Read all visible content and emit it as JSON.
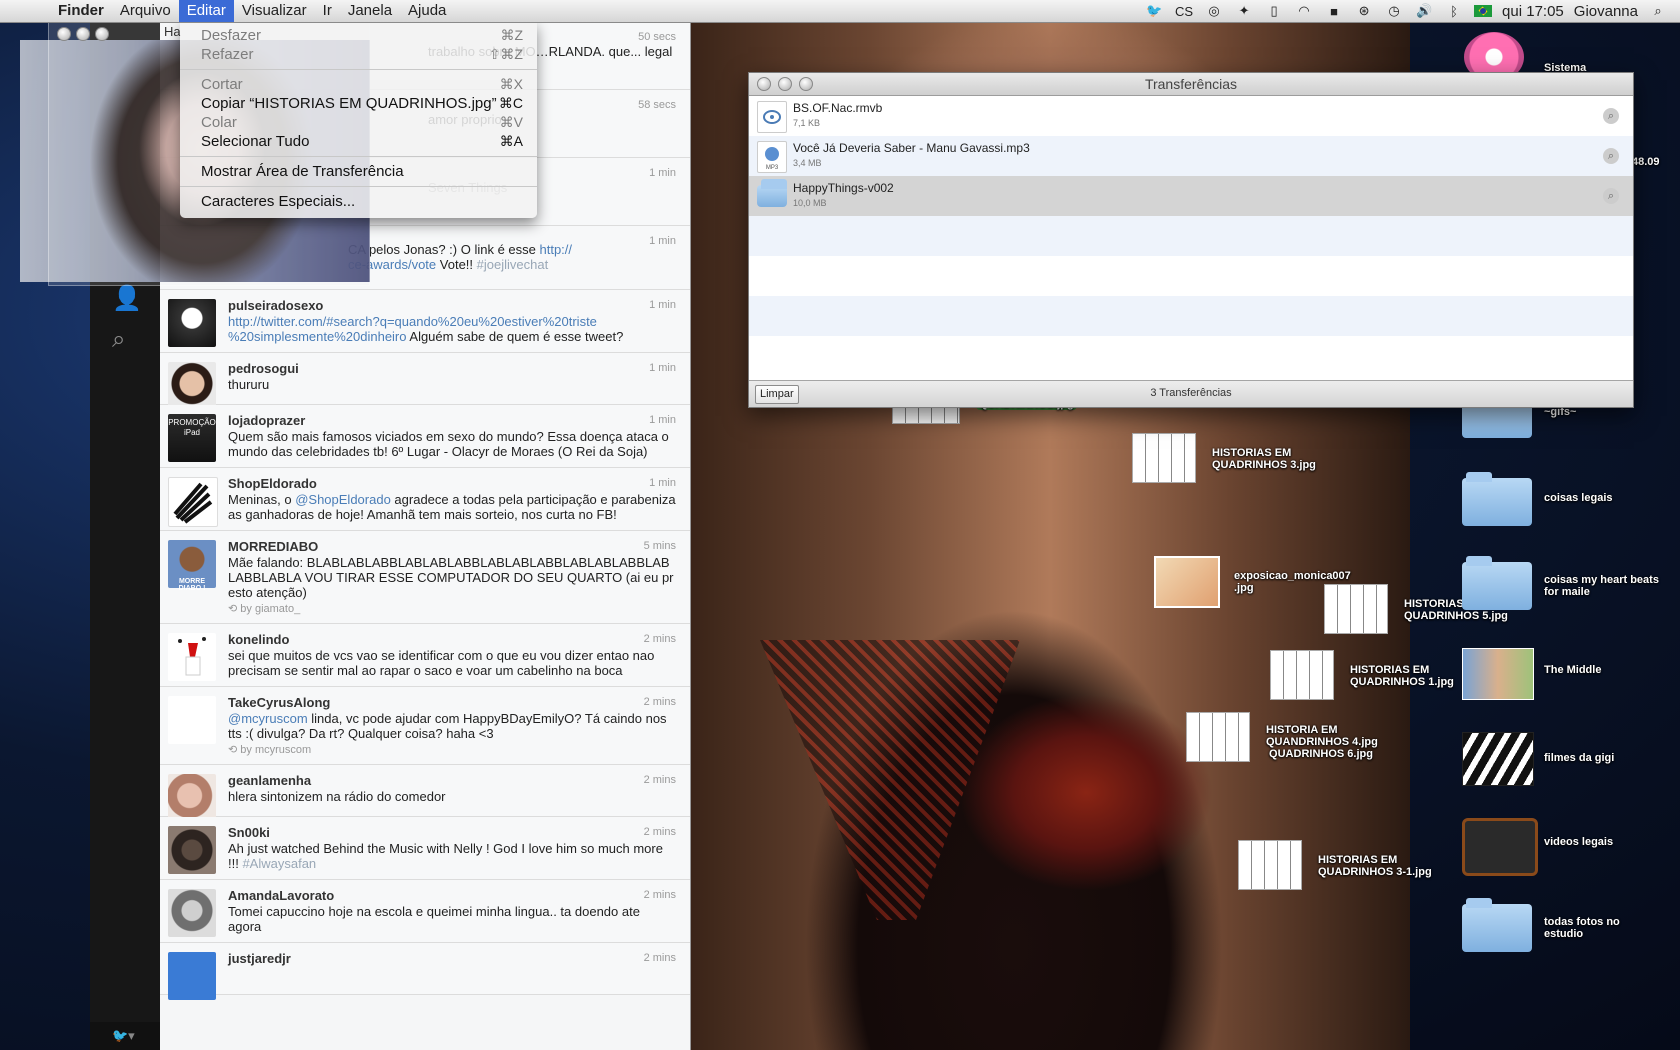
{
  "menubar": {
    "app": "Finder",
    "menus": [
      "Arquivo",
      "Editar",
      "Visualizar",
      "Ir",
      "Janela",
      "Ajuda"
    ],
    "active_menu": "Editar",
    "clock": "qui 17:05",
    "user": "Giovanna",
    "status_icons": [
      "twitter-icon",
      "cs-icon",
      "skype-icon",
      "growl-icon",
      "battery-icon",
      "wifi-icon",
      "evernote-icon",
      "accessibility-icon",
      "timemachine-icon",
      "volume-icon",
      "bluetooth-icon",
      "flag-icon",
      "spotlight-icon"
    ],
    "cs_label": "CS"
  },
  "edit_menu": {
    "items": [
      {
        "label": "Desfazer",
        "shortcut": "⌘Z",
        "enabled": false
      },
      {
        "label": "Refazer",
        "shortcut": "⇧⌘Z",
        "enabled": false
      },
      {
        "label": "Cortar",
        "shortcut": "⌘X",
        "enabled": false
      },
      {
        "label": "Copiar “HISTORIAS EM QUADRINHOS.jpg”",
        "shortcut": "⌘C",
        "enabled": true
      },
      {
        "label": "Colar",
        "shortcut": "⌘V",
        "enabled": false
      },
      {
        "label": "Selecionar Tudo",
        "shortcut": "⌘A",
        "enabled": true
      },
      {
        "label": "Mostrar Área de Transferência",
        "shortcut": "",
        "enabled": true
      },
      {
        "label": "Caracteres Especiais...",
        "shortcut": "",
        "enabled": true
      }
    ]
  },
  "webcam": {
    "title_fragment": "Ha"
  },
  "timeline": {
    "partial": [
      {
        "time": "50 secs",
        "text": "trabalho sobre MO…RLANDA. que... legal"
      },
      {
        "time": "58 secs",
        "text": "amor proprio"
      },
      {
        "time": "1 min",
        "text": "Seven Things"
      },
      {
        "time": "1 min",
        "text_prefix": "CA pelos Jonas? :) O link é esse ",
        "link": "http://",
        "link2": "ce-awards/vote",
        "text_suffix": " Vote!! ",
        "hash": "#joejlivechat"
      }
    ],
    "tweets": [
      {
        "user": "pulseiradosexo",
        "time": "1 min",
        "link": "http://twitter.com/#search?q=quando%20eu%20estiver%20triste%20simplesmente%20dinheiro",
        "link_text": "http://twitter.com/#search?q=quando%20eu%20estiver%20triste %20simplesmente%20dinheiro",
        "text": " Alguém sabe de quem é esse tweet?",
        "avatar": "#1a1a1a"
      },
      {
        "user": "pedrosogui",
        "time": "1 min",
        "text": "thururu",
        "avatar": "#d7b39b"
      },
      {
        "user": "lojadoprazer",
        "time": "1 min",
        "text": "Quem são mais famosos viciados em sexo do mundo?  Essa doença ataca o mundo das celebridades tb! 6º Lugar - Olacyr de Moraes (O Rei da Soja)",
        "avatar": "#2c2c2c",
        "avatar_text": "PROMOÇÃO iPad"
      },
      {
        "user": "ShopEldorado",
        "time": "1 min",
        "text_prefix": "Meninas, o ",
        "mention": "@ShopEldorado",
        "text": " agradece a todas pela participação e parabeniza as ganhadoras de hoje! Amanhã tem mais sorteio, nos curta no FB!",
        "avatar": "#ffffff"
      },
      {
        "user": "MORREDIABO",
        "time": "5 mins",
        "text": "Mãe falando: BLABLABLABBLABLABLABBLABLABLABBLABLABLABBLABLABBLABLA VOU TIRAR ESSE COMPUTADOR DO SEU QUARTO (ai eu presto atenção)",
        "rt": "by giamato_",
        "avatar": "#6b8fc4",
        "avatar_text": "MORRE DIABO !"
      },
      {
        "user": "konelindo",
        "time": "2 mins",
        "text": "sei que muitos de vcs vao se identificar com o que eu vou dizer entao nao precisam se sentir mal ao rapar o saco e voar um cabelinho na boca",
        "avatar": "#ffffff"
      },
      {
        "user": "TakeCyrusAlong",
        "time": "2 mins",
        "mention": "@mcyruscom",
        "text": " linda, vc pode ajudar com HappyBDayEmilyO? Tá caindo nos tts :( divulga? Da rt? Qualquer coisa? haha <3",
        "rt": "by mcyruscom",
        "avatar": "#ffffff"
      },
      {
        "user": "geanlamenha",
        "time": "2 mins",
        "text": "hlera sintonizem na rádio do comedor",
        "avatar": "#c99a86"
      },
      {
        "user": "Sn00ki",
        "time": "2 mins",
        "text": "Ah just watched Behind the Music with Nelly ! God I love him so much more !!! ",
        "hash": "#Alwaysafan",
        "avatar": "#3b2f2a"
      },
      {
        "user": "AmandaLavorato",
        "time": "2 mins",
        "text": "Tomei capuccino hoje na escola e queimei minha lingua.. ta doendo ate agora",
        "avatar": "#8e8e8e"
      },
      {
        "user": "justjaredjr",
        "time": "2 mins",
        "text": "",
        "avatar": "#3a7bd5"
      }
    ]
  },
  "transfers": {
    "title": "Transferências",
    "items": [
      {
        "name": "BS.OF.Nac.rmvb",
        "size": "7,1 KB",
        "icon": "video-file-icon"
      },
      {
        "name": "Você Já Deveria Saber - Manu Gavassi.mp3",
        "size": "3,4 MB",
        "icon": "mp3-file-icon"
      },
      {
        "name": "HappyThings-v002",
        "size": "10,0 MB",
        "icon": "folder-icon"
      }
    ],
    "clear_label": "Limpar",
    "count": "3 Transferências"
  },
  "desktop": {
    "hidden_label": "QUADRINHOS.jpg",
    "files": [
      {
        "label": "HISTORIAS EM\nQUADRINHOS 3.jpg"
      },
      {
        "label": "exposicao_monica007\n.jpg"
      },
      {
        "label": "HISTORIAS EM\nQUADRINHOS 5.jpg"
      },
      {
        "label": "HISTORIAS EM\nQUADRINHOS 1.jpg"
      },
      {
        "label": "HISTORIA EM\nQUANDRINHOS 4.jpg\n QUADRINHOS 6.jpg"
      },
      {
        "label": "HISTORIAS EM\nQUADRINHOS 3-1.jpg"
      }
    ],
    "right_column": [
      {
        "label": "Sistema"
      },
      {
        "label": "~gifs~"
      },
      {
        "label": "coisas legais"
      },
      {
        "label": "coisas my heart beats\nfor maile"
      },
      {
        "label": "The Middle"
      },
      {
        "label": "filmes da gigi"
      },
      {
        "label": "videos legais"
      },
      {
        "label": "todas fotos no\nestudio"
      }
    ],
    "partial_right": "48.09"
  }
}
